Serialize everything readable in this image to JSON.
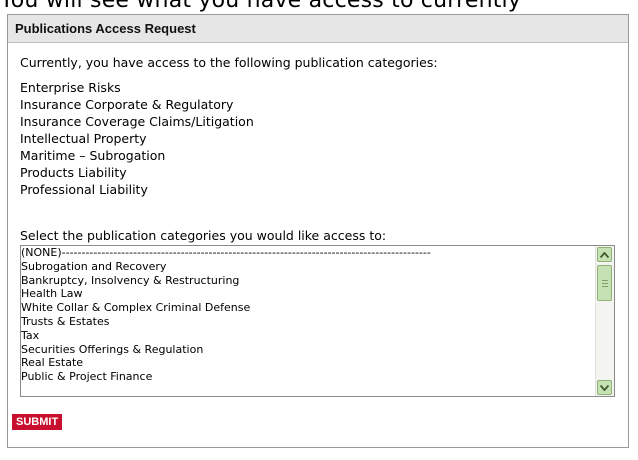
{
  "header_fragment": "You will see what you have access to currently",
  "panel": {
    "title": "Publications Access Request"
  },
  "current_access": {
    "intro": "Currently, you have access to the following publication categories:",
    "categories": [
      "Enterprise Risks",
      "Insurance Corporate & Regulatory",
      "Insurance Coverage Claims/Litigation",
      "Intellectual Property",
      "Maritime – Subrogation",
      "Products Liability",
      "Professional Liability"
    ]
  },
  "selection": {
    "prompt": "Select the publication categories you would like access to:",
    "options": [
      "(NONE)---------------------------------------------------------------------------------------------",
      "Subrogation and Recovery",
      "Bankruptcy, Insolvency & Restructuring",
      "Health Law",
      "White Collar & Complex Criminal Defense",
      "Trusts & Estates",
      "Tax",
      "Securities Offerings & Regulation",
      "Real Estate",
      "Public & Project Finance"
    ],
    "scroll_position_fraction": 0.0
  },
  "submit_label": "SUBMIT",
  "colors": {
    "header_bg": "#e6e6e6",
    "submit_bg": "#c8102e",
    "scrollbar_accent": "#c6e1b3"
  },
  "icons": [
    "scroll-up-arrow-icon",
    "scroll-down-arrow-icon"
  ]
}
